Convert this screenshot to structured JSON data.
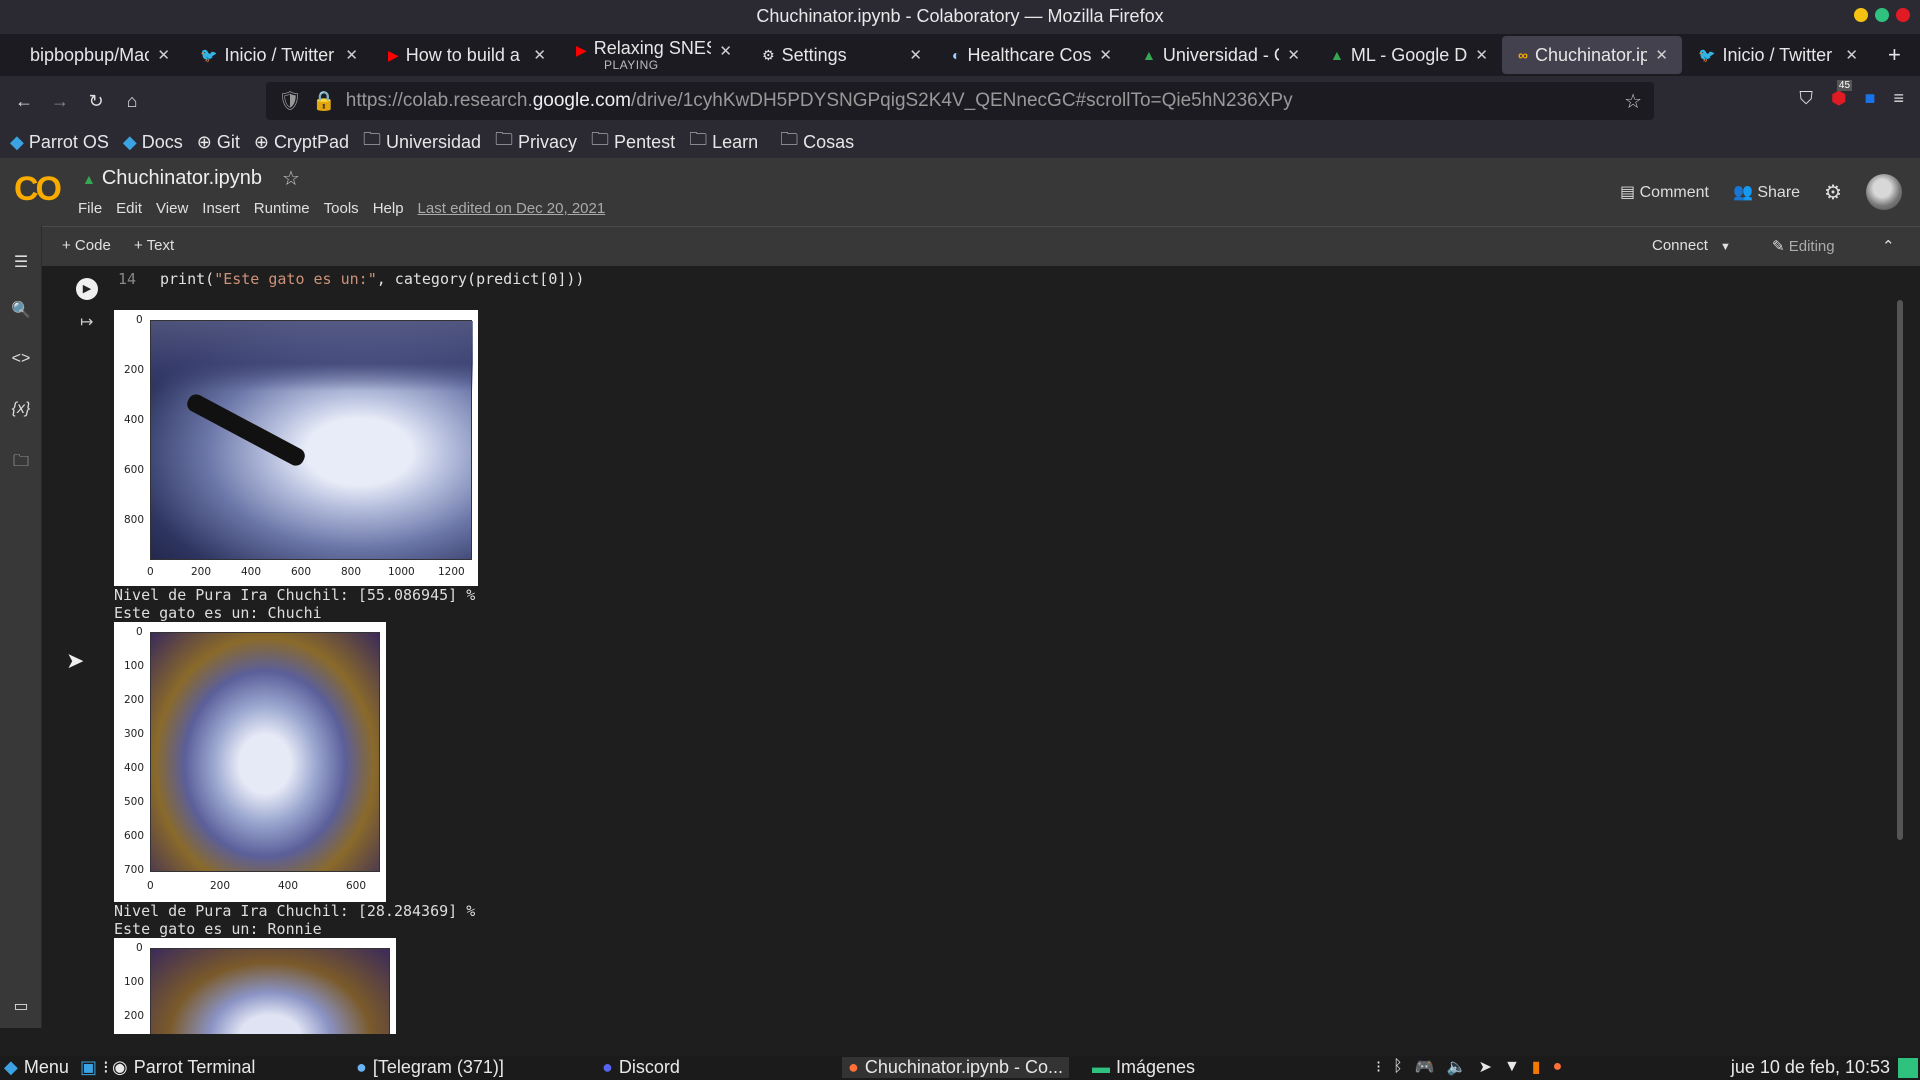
{
  "window": {
    "title": "Chuchinator.ipynb - Colaboratory — Mozilla Firefox"
  },
  "tabs": [
    {
      "label": "bipbopbup/Mac",
      "icon": "github-icon"
    },
    {
      "label": "Inicio / Twitter",
      "icon": "twitter-icon"
    },
    {
      "label": "How to build a p",
      "icon": "youtube-icon"
    },
    {
      "label": "Relaxing SNES t",
      "sub": "PLAYING",
      "icon": "youtube-icon"
    },
    {
      "label": "Settings",
      "icon": "gear-icon"
    },
    {
      "label": "Healthcare Cost",
      "icon": "globe-icon"
    },
    {
      "label": "Universidad - G",
      "icon": "drive-icon"
    },
    {
      "label": "ML - Google Dr",
      "icon": "drive-icon"
    },
    {
      "label": "Chuchinator.ipy",
      "icon": "colab-icon",
      "active": true
    },
    {
      "label": "Inicio / Twitter",
      "icon": "twitter-icon"
    }
  ],
  "url": {
    "prefix": "https://colab.research.",
    "domain": "google.com",
    "path": "/drive/1cyhKwDH5PDYSNGPqigS2K4V_QENnecGC#scrollTo=Qie5hN236XPy"
  },
  "nav": {
    "badge": "45"
  },
  "bookmarks": [
    "Parrot OS",
    "Docs",
    "Git",
    "CryptPad",
    "Universidad",
    "Privacy",
    "Pentest",
    "Learn",
    "Cosas"
  ],
  "colab": {
    "logo": "CO",
    "notebook_title": "Chuchinator.ipynb",
    "menus": [
      "File",
      "Edit",
      "View",
      "Insert",
      "Runtime",
      "Tools",
      "Help"
    ],
    "last_edited": "Last edited on Dec 20, 2021",
    "comment": "Comment",
    "share": "Share"
  },
  "toolbar": {
    "add_code": "+ Code",
    "add_text": "+ Text",
    "connect": "Connect",
    "editing": "Editing"
  },
  "cell": {
    "line_number": "14",
    "code_a": "print(",
    "code_str": "\"Este gato es un:\"",
    "code_b": ", category(predict[0]))"
  },
  "outputs": [
    {
      "xticks": [
        "0",
        "200",
        "400",
        "600",
        "800",
        "1000",
        "1200"
      ],
      "yticks": [
        "0",
        "200",
        "400",
        "600",
        "800"
      ],
      "line1": "Nivel de Pura Ira Chuchil: [55.086945] %",
      "line2": "Este gato es un: Chuchi"
    },
    {
      "xticks": [
        "0",
        "200",
        "400",
        "600"
      ],
      "yticks": [
        "0",
        "100",
        "200",
        "300",
        "400",
        "500",
        "600",
        "700"
      ],
      "line1": "Nivel de Pura Ira Chuchil: [28.284369] %",
      "line2": "Este gato es un: Ronnie"
    },
    {
      "yticks": [
        "0",
        "100",
        "200"
      ]
    }
  ],
  "taskbar": {
    "menu": "Menu",
    "items": [
      "Parrot Terminal",
      "[Telegram (371)]",
      "Discord",
      "Chuchinator.ipynb - Co...",
      "Imágenes"
    ],
    "clock": "jue 10 de feb, 10:53"
  }
}
